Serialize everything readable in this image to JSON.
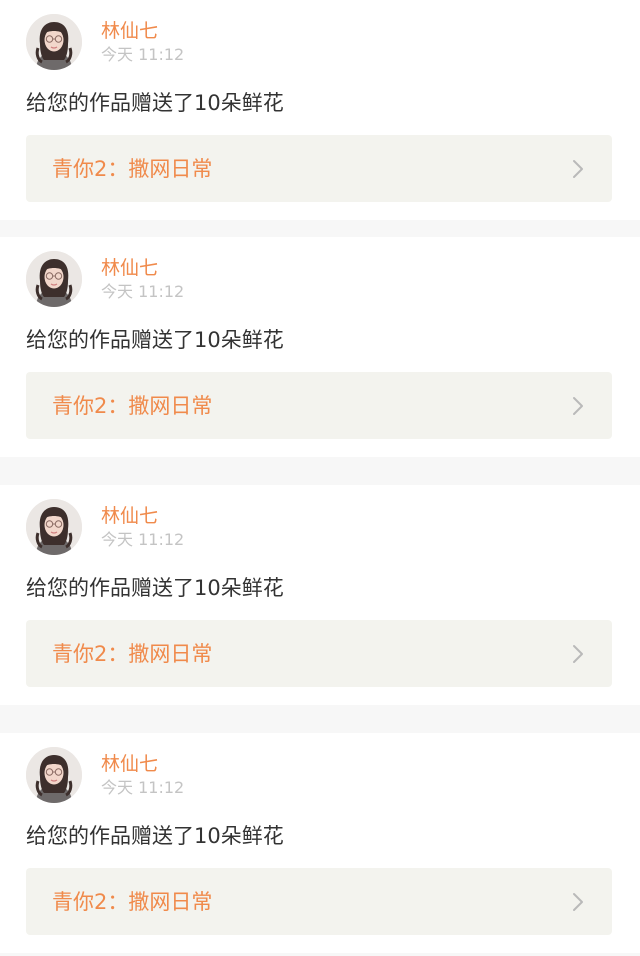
{
  "notifications": [
    {
      "user_name": "林仙七",
      "time": "今天 11:12",
      "message": "给您的作品赠送了10朵鲜花",
      "work_title": "青你2：撒网日常",
      "avatar_icon": "avatar-photo",
      "chevron_icon": "chevron-right-icon"
    },
    {
      "user_name": "林仙七",
      "time": "今天 11:12",
      "message": "给您的作品赠送了10朵鲜花",
      "work_title": "青你2：撒网日常",
      "avatar_icon": "avatar-photo",
      "chevron_icon": "chevron-right-icon"
    },
    {
      "user_name": "林仙七",
      "time": "今天 11:12",
      "message": "给您的作品赠送了10朵鲜花",
      "work_title": "青你2：撒网日常",
      "avatar_icon": "avatar-photo",
      "chevron_icon": "chevron-right-icon"
    },
    {
      "user_name": "林仙七",
      "time": "今天 11:12",
      "message": "给您的作品赠送了10朵鲜花",
      "work_title": "青你2：撒网日常",
      "avatar_icon": "avatar-photo",
      "chevron_icon": "chevron-right-icon"
    }
  ],
  "colors": {
    "accent": "#f08a4b",
    "time_text": "#c4c4c4",
    "body_text": "#333333",
    "link_bg": "#f3f3ee",
    "separator": "#f7f7f7"
  }
}
